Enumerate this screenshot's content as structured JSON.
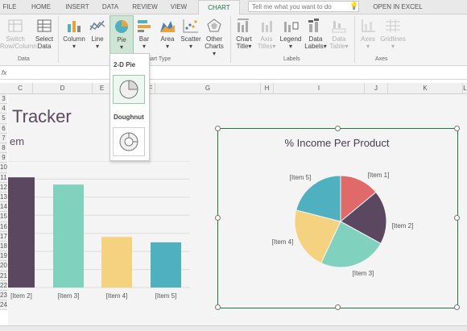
{
  "tabs": [
    "FILE",
    "HOME",
    "INSERT",
    "DATA",
    "REVIEW",
    "VIEW",
    "CHART"
  ],
  "active_tab": "CHART",
  "tell_me": {
    "placeholder": "Tell me what you want to do"
  },
  "open_in_excel": "OPEN IN EXCEL",
  "ribbon": {
    "switch": {
      "line1": "Switch",
      "line2": "Row/Column"
    },
    "select_data": {
      "line1": "Select",
      "line2": "Data"
    },
    "group_data": "Data",
    "column": "Column",
    "line": "Line",
    "pie": "Pie",
    "bar": "Bar",
    "area": "Area",
    "scatter": "Scatter",
    "other": {
      "line1": "Other",
      "line2": "Charts"
    },
    "group_chart_type": "Chart Type",
    "chart_title": {
      "line1": "Chart",
      "line2": "Title"
    },
    "axis_titles": {
      "line1": "Axis",
      "line2": "Titles"
    },
    "legend": "Legend",
    "data_labels": {
      "line1": "Data",
      "line2": "Labels"
    },
    "data_table": {
      "line1": "Data",
      "line2": "Table"
    },
    "group_labels": "Labels",
    "axes": "Axes",
    "gridlines": "Gridlines",
    "group_axes": "Axes"
  },
  "fx_label": "fx",
  "columns": [
    "C",
    "D",
    "E",
    "F",
    "G",
    "H",
    "I",
    "J",
    "K",
    "L"
  ],
  "rows": [
    "3",
    "4",
    "5",
    "6",
    "7",
    "8",
    "9",
    "10",
    "11",
    "12",
    "13",
    "14",
    "15",
    "16",
    "17",
    "18",
    "19",
    "20",
    "21",
    "22",
    "23",
    "24"
  ],
  "dropdown": {
    "section1": "2-D Pie",
    "section2": "Doughnut"
  },
  "sheet": {
    "title": "Tracker",
    "subtitle": "em"
  },
  "colors": {
    "accent": "#217346",
    "item1": "#e06a6a",
    "item2": "#5c4760",
    "item3": "#80d2bf",
    "item4": "#f4d27f",
    "item5": "#4fb0c0"
  },
  "chart_data": [
    {
      "type": "bar",
      "categories": [
        "[Item 2]",
        "[Item 3]",
        "[Item 4]",
        "[Item 5]"
      ],
      "values": [
        6.1,
        5.7,
        2.8,
        2.5
      ],
      "colors": [
        "#5c4760",
        "#80d2bf",
        "#f4d27f",
        "#4fb0c0"
      ],
      "ylim": [
        0,
        7
      ],
      "grid": true
    },
    {
      "type": "pie",
      "title": "% Income Per Product",
      "categories": [
        "[Item 1]",
        "[Item 2]",
        "[Item 3]",
        "[Item 4]",
        "[Item 5]"
      ],
      "values": [
        14,
        19,
        24,
        22,
        21
      ],
      "colors": [
        "#e06a6a",
        "#5c4760",
        "#80d2bf",
        "#f4d27f",
        "#4fb0c0"
      ]
    }
  ]
}
